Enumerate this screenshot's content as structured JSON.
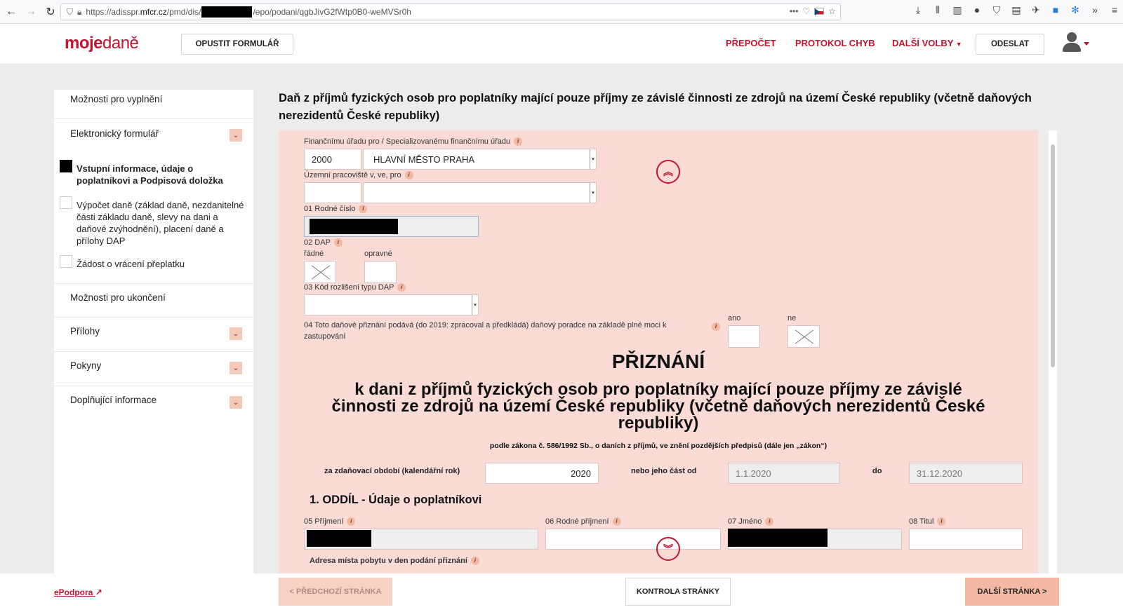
{
  "browser": {
    "url_prefix": "https://adisspr.",
    "url_host": "mfcr.cz",
    "url_path1": "/pmd/dis/",
    "url_path2": "/epo/podani/qgbJivG2fWtp0B0-weMVSr0h",
    "more": "•••"
  },
  "header": {
    "logo_a": "moje",
    "logo_b": "daně",
    "exit_button": "OPUSTIT FORMULÁŘ",
    "recalc": "PŘEPOČET",
    "error_log": "PROTOKOL CHYB",
    "more_options": "DALŠÍ VOLBY",
    "send": "ODESLAT"
  },
  "sidebar": {
    "fill_options": "Možnosti pro vyplnění",
    "electronic_form": "Elektronický formulář",
    "sub1": "Vstupní informace, údaje o poplatníkovi a Podpisová doložka",
    "sub2": "Výpočet daně (základ daně, nezdanitelné části základu daně, slevy na dani a daňové zvýhodnění), placení daně a přílohy DAP",
    "sub3": "Žádost o vrácení přeplatku",
    "end_options": "Možnosti pro ukončení",
    "attachments": "Přílohy",
    "instructions": "Pokyny",
    "additional_info": "Doplňující informace"
  },
  "main": {
    "title": "Daň z příjmů fyzických osob pro poplatníky mající pouze příjmy ze závislé činnosti ze zdrojů na území České republiky (včetně daňových nerezidentů České republiky)"
  },
  "form": {
    "office_label": "Finančnímu úřadu pro / Specializovanému finančnímu úřadu",
    "office_code": "2000",
    "office_name": "HLAVNÍ MĚSTO PRAHA",
    "territory_label": "Územní pracoviště v, ve, pro",
    "birth_number_label": "01 Rodné číslo",
    "dap_label": "02 DAP",
    "dap_regular": "řádné",
    "dap_corrective": "opravné",
    "dap_type_label": "03 Kód rozlišení typu DAP",
    "advisor_label": "04 Toto daňové přiznání podává (do 2019: zpracoval a předkládá) daňový poradce na základě plné moci k zastupování",
    "yes": "ano",
    "no": "ne",
    "heading": "PŘIZNÁNÍ",
    "subheading": "k dani z příjmů fyzických osob pro poplatníky mající pouze příjmy ze závislé činnosti ze zdrojů na území České republiky (včetně daňových nerezidentů České republiky)",
    "law": "podle zákona č. 586/1992 Sb., o daních z příjmů, ve znění pozdějších předpisů (dále jen „zákon“)",
    "period_label": "za zdaňovací období (kalendářní rok)",
    "period_value": "2020",
    "part_from_label": "nebo jeho část od",
    "part_from_value": "1.1.2020",
    "to_label": "do",
    "to_value": "31.12.2020",
    "section1": "1. ODDÍL - Údaje o poplatníkovi",
    "surname_label": "05 Příjmení",
    "birth_surname_label": "06 Rodné příjmení",
    "name_label": "07 Jméno",
    "title_label": "08 Titul",
    "address_label": "Adresa místa pobytu v den podání přiznání"
  },
  "footer": {
    "epodpora": "ePodpora",
    "prev": "< PŘEDCHOZÍ STRÁNKA",
    "check": "KONTROLA STRÁNKY",
    "next": "DALŠÍ STRÁNKA >"
  }
}
